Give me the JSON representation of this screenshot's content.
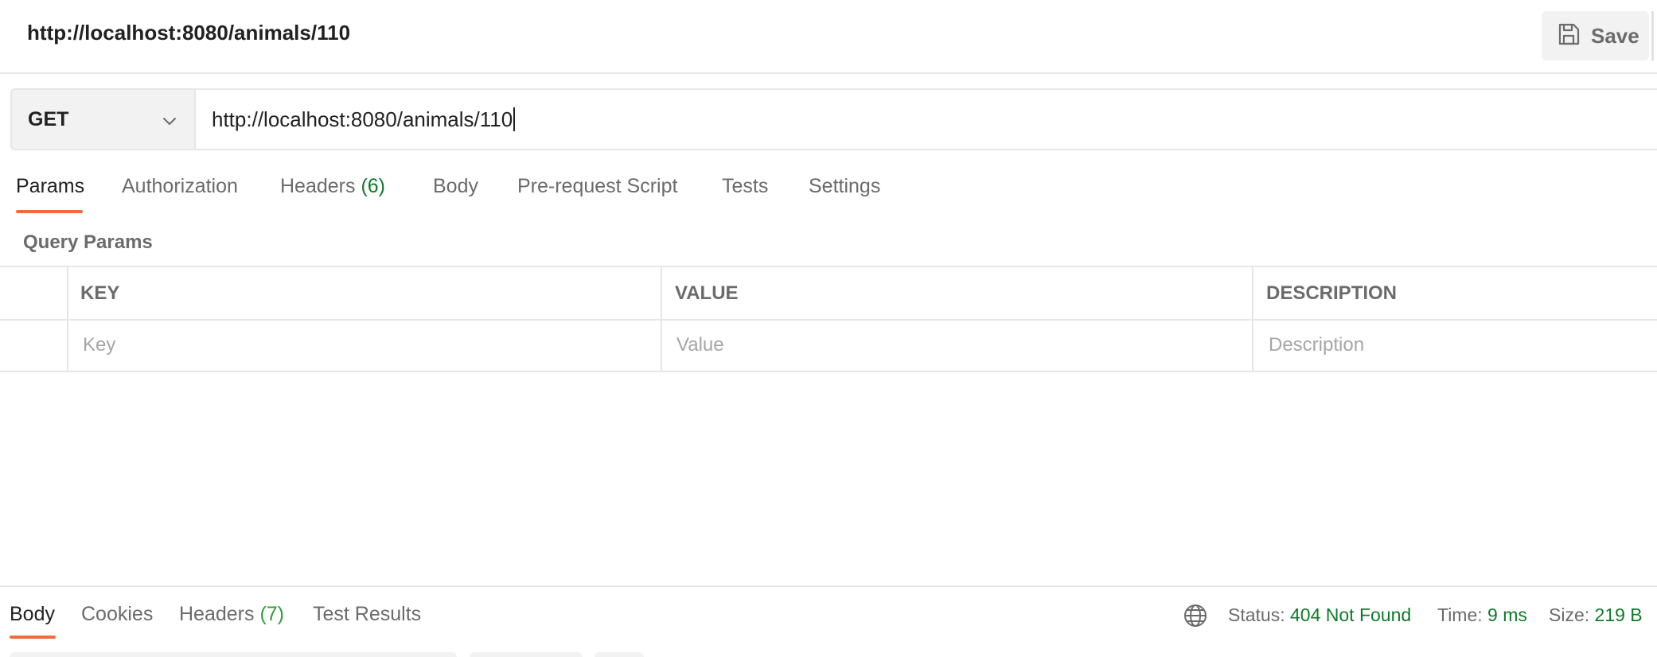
{
  "header": {
    "title": "http://localhost:8080/animals/110",
    "save_label": "Save"
  },
  "request": {
    "method": "GET",
    "url": "http://localhost:8080/animals/110"
  },
  "tabs": [
    {
      "label": "Params",
      "count": ""
    },
    {
      "label": "Authorization",
      "count": ""
    },
    {
      "label": "Headers",
      "count": "(6)"
    },
    {
      "label": "Body",
      "count": ""
    },
    {
      "label": "Pre-request Script",
      "count": ""
    },
    {
      "label": "Tests",
      "count": ""
    },
    {
      "label": "Settings",
      "count": ""
    }
  ],
  "active_tab": "Params",
  "query_params": {
    "section_label": "Query Params",
    "columns": [
      "KEY",
      "VALUE",
      "DESCRIPTION"
    ],
    "placeholders": [
      "Key",
      "Value",
      "Description"
    ]
  },
  "response": {
    "tabs": [
      {
        "label": "Body",
        "count": ""
      },
      {
        "label": "Cookies",
        "count": ""
      },
      {
        "label": "Headers",
        "count": "(7)"
      },
      {
        "label": "Test Results",
        "count": ""
      }
    ],
    "active_tab": "Body",
    "status_label": "Status:",
    "status_value": "404 Not Found",
    "time_label": "Time:",
    "time_value": "9 ms",
    "size_label": "Size:",
    "size_value": "219 B"
  },
  "colors": {
    "accent": "#f26b3a",
    "success": "#0f7b29",
    "muted": "#6b6b6b"
  }
}
